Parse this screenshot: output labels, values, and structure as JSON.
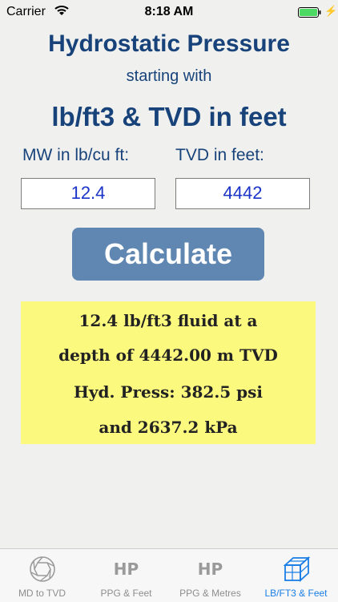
{
  "status_bar": {
    "carrier": "Carrier",
    "time": "8:18 AM",
    "wifi_icon": "wifi-icon",
    "battery_icon": "battery-icon",
    "battery_level": 1.0,
    "battery_color": "#4cd964"
  },
  "header": {
    "title": "Hydrostatic Pressure",
    "subtitle": "starting with",
    "unit_heading": "lb/ft3 & TVD in feet"
  },
  "form": {
    "mw_label": "MW in lb/cu ft:",
    "mw_value": "12.4",
    "tvd_label": "TVD in feet:",
    "tvd_value": "4442",
    "calculate_label": "Calculate"
  },
  "result": {
    "line1": "12.4 lb/ft3 fluid at a",
    "line2": "depth of 4442.00 m TVD",
    "line3": "Hyd. Press: 382.5 psi",
    "line4": "and 2637.2 kPa"
  },
  "tabs": [
    {
      "label": "MD to TVD",
      "icon": "camera-shutter-icon",
      "active": false
    },
    {
      "label": "PPG & Feet",
      "icon": "hp-icon",
      "icon_text": "HP",
      "active": false
    },
    {
      "label": "PPG & Metres",
      "icon": "hp-icon",
      "icon_text": "HP",
      "active": false
    },
    {
      "label": "LB/FT3 & Feet",
      "icon": "cube-icon",
      "active": true
    }
  ],
  "colors": {
    "heading": "#17427a",
    "button": "#5f87b1",
    "result_bg": "#fcf97f",
    "tab_active": "#1a7ee6",
    "input_text": "#1a33c8"
  }
}
